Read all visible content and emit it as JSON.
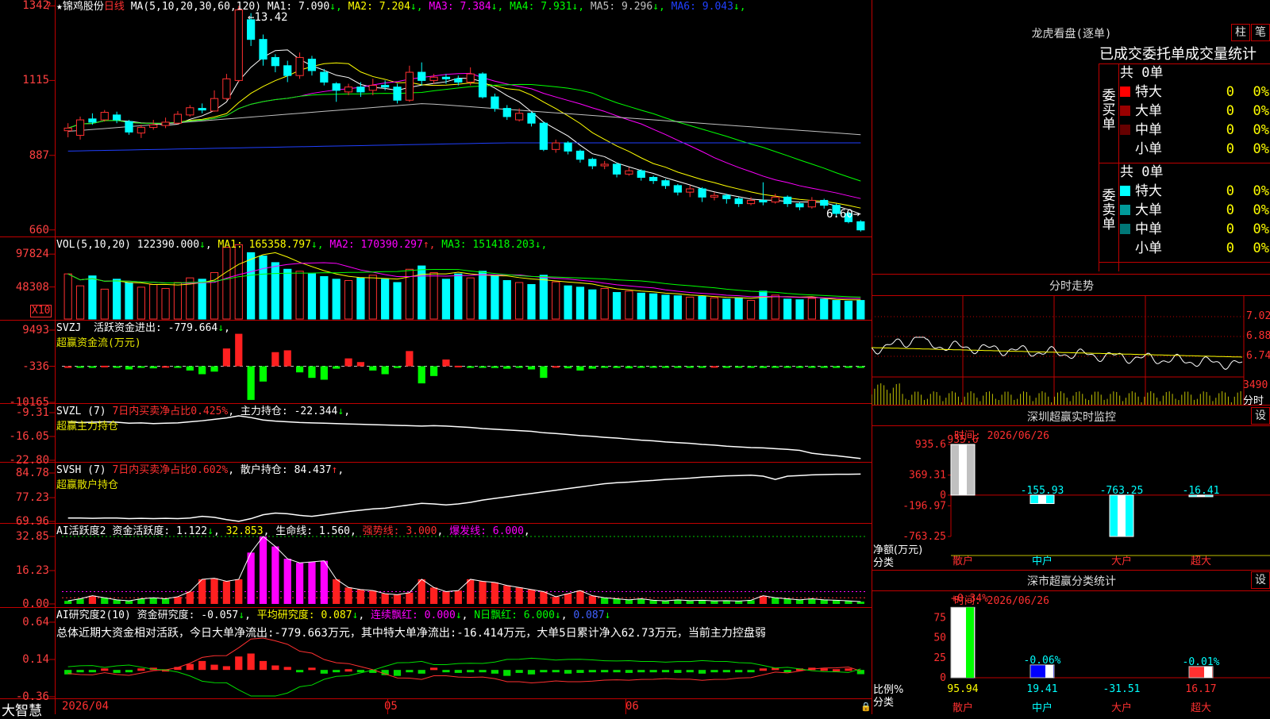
{
  "stock": {
    "name": "锦鸡股份",
    "period": "日线",
    "ma_title": "MA(5,10,20,30,60,120)"
  },
  "main_legend": [
    {
      "label": "MA1:",
      "value": "7.090",
      "arrow": "↓",
      "color": "#ffffff"
    },
    {
      "label": "MA2:",
      "value": "7.204",
      "arrow": "↓",
      "color": "#ffff00"
    },
    {
      "label": "MA3:",
      "value": "7.384",
      "arrow": "↓",
      "color": "#ff00ff"
    },
    {
      "label": "MA4:",
      "value": "7.931",
      "arrow": "↓",
      "color": "#00ff00"
    },
    {
      "label": "MA5:",
      "value": "9.296",
      "arrow": "↓",
      "color": "#c0c0c0"
    },
    {
      "label": "MA6:",
      "value": "9.043",
      "arrow": "↓",
      "color": "#2040ff"
    }
  ],
  "main_yticks": [
    "1342",
    "1115",
    "887",
    "660"
  ],
  "main_annotations": {
    "high": "13.42",
    "low": "6.60"
  },
  "vol": {
    "title": "VOL(5,10,20)",
    "value": "122390.000",
    "arrow": "↓",
    "legend": [
      {
        "label": "MA1:",
        "value": "165358.797",
        "arrow": "↓",
        "color": "#ffff00"
      },
      {
        "label": "MA2:",
        "value": "170390.297",
        "arrow": "↑",
        "color": "#ff00ff"
      },
      {
        "label": "MA3:",
        "value": "151418.203",
        "arrow": "↓",
        "color": "#00ff00"
      }
    ],
    "yticks": [
      "97824",
      "48308"
    ],
    "unit": "X10"
  },
  "svzj": {
    "title": "SVZJ",
    "label": "活跃资金进出:",
    "value": "-779.664",
    "arrow": "↓",
    "subtitle": "超赢资金流(万元)",
    "yticks": [
      "9493",
      "-336",
      "-10165"
    ]
  },
  "svzl": {
    "title": "SVZL (7)",
    "label1": "7日内买卖净占比",
    "v1": "0.425%",
    "label2": "主力持仓:",
    "v2": "-22.344",
    "arrow": "↓",
    "subtitle": "超赢主力持仓",
    "yticks": [
      "-9.31",
      "-16.05",
      "-22.80"
    ]
  },
  "svsh": {
    "title": "SVSH (7)",
    "label1": "7日内买卖净占比",
    "v1": "0.602%",
    "label2": "散户持仓:",
    "v2": "84.437",
    "arrow": "↑",
    "subtitle": "超赢散户持仓",
    "yticks": [
      "84.78",
      "77.23",
      "69.96"
    ]
  },
  "ai1": {
    "title": "AI活跃度2",
    "l1": "资金活跃度:",
    "v1": "1.122",
    "a1": "↓",
    "v1b": "32.853",
    "l2": "生命线:",
    "v2": "1.560",
    "l3": "强势线:",
    "v3": "3.000",
    "l4": "爆发线:",
    "v4": "6.000",
    "yticks": [
      "32.85",
      "16.23",
      "0.00"
    ]
  },
  "ai2": {
    "title": "AI研究度2(10)",
    "l1": "资金研究度:",
    "v1": "-0.057",
    "a1": "↓",
    "l2": "平均研究度:",
    "v2": "0.087",
    "a2": "↓",
    "l3": "连续飘红:",
    "v3": "0.000",
    "a3": "↓",
    "l4": "N日飘红:",
    "v4": "6.000",
    "a4": "↓",
    "v5": "0.087",
    "a5": "↓",
    "summary": "总体近期大资金相对活跃，今日大单净流出:-779.663万元，其中特大单净流出:-16.414万元，大单5日累计净入62.73万元，当前主力控盘弱",
    "yticks": [
      "0.64",
      "0.14",
      "-0.36"
    ]
  },
  "xaxis": {
    "logo": "大智慧",
    "labels": [
      "2026/04",
      "05",
      "06"
    ]
  },
  "corner_marks": [
    "?",
    "?"
  ],
  "longhu": {
    "title": "龙虎看盘(逐单)",
    "btn1": "柱",
    "btn2": "笔",
    "subtitle": "已成交委托单成交量统计",
    "buy": {
      "side": "委买单",
      "total": "共 0单",
      "rows": [
        {
          "label": "特大",
          "n": "0",
          "pct": "0%",
          "color": "#ff0000"
        },
        {
          "label": "大单",
          "n": "0",
          "pct": "0%",
          "color": "#990000"
        },
        {
          "label": "中单",
          "n": "0",
          "pct": "0%",
          "color": "#660000"
        },
        {
          "label": "小单",
          "n": "0",
          "pct": "0%",
          "color": "#000000"
        }
      ]
    },
    "sell": {
      "side": "委卖单",
      "total": "共 0单",
      "rows": [
        {
          "label": "特大",
          "n": "0",
          "pct": "0%",
          "color": "#00ffff"
        },
        {
          "label": "大单",
          "n": "0",
          "pct": "0%",
          "color": "#009999"
        },
        {
          "label": "中单",
          "n": "0",
          "pct": "0%",
          "color": "#007777"
        },
        {
          "label": "小单",
          "n": "0",
          "pct": "0%",
          "color": "#000000"
        }
      ]
    }
  },
  "fenshi": {
    "title": "分时走势",
    "yticks": [
      "7.02",
      "6.88",
      "6.74"
    ],
    "vol_label": "3490",
    "vol_unit": "分时"
  },
  "szmon": {
    "title": "深圳超赢实时监控",
    "btn": "设",
    "time": "时间: 2026/06/26",
    "yticks": [
      "935.6",
      "369.31",
      "0",
      "-196.97",
      "-763.25"
    ],
    "ylabel": "净额(万元)",
    "xlabel": "分类",
    "values": [
      "935.6",
      "-155.93",
      "-763.25",
      "-16.41"
    ],
    "cats": [
      "散户",
      "中户",
      "大户",
      "超大"
    ]
  },
  "szcls": {
    "title": "深市超赢分类统计",
    "btn": "设",
    "time": "时间: 2026/06/26",
    "yticks": [
      "75",
      "50",
      "25",
      "0"
    ],
    "ylabel": "比例%",
    "xlabel": "分类",
    "top": [
      "+0.34%",
      "-0.06%",
      "-0.01%"
    ],
    "bottom": [
      "95.94",
      "19.41",
      "-31.51",
      "16.17"
    ],
    "cats": [
      "散户",
      "中户",
      "大户",
      "超大"
    ]
  },
  "chart_data": [
    {
      "type": "candlestick",
      "title": "锦鸡股份 日线",
      "ylim": [
        6.4,
        13.6
      ],
      "candles": [
        [
          9.62,
          9.7,
          9.42,
          9.85
        ],
        [
          9.48,
          9.95,
          9.35,
          10.05
        ],
        [
          9.98,
          9.88,
          9.8,
          10.15
        ],
        [
          9.95,
          10.18,
          9.9,
          10.25
        ],
        [
          10.1,
          9.95,
          9.85,
          10.2
        ],
        [
          9.9,
          9.58,
          9.5,
          9.95
        ],
        [
          9.55,
          9.72,
          9.4,
          9.8
        ],
        [
          9.72,
          9.8,
          9.65,
          9.95
        ],
        [
          9.78,
          9.88,
          9.7,
          10.02
        ],
        [
          9.85,
          10.12,
          9.82,
          10.22
        ],
        [
          10.1,
          10.32,
          10.05,
          10.4
        ],
        [
          10.3,
          10.25,
          10.15,
          10.45
        ],
        [
          10.22,
          10.6,
          10.2,
          10.85
        ],
        [
          10.6,
          11.2,
          10.55,
          11.35
        ],
        [
          11.15,
          13.3,
          11.1,
          13.42
        ],
        [
          13.0,
          12.4,
          12.2,
          13.2
        ],
        [
          12.4,
          11.8,
          11.6,
          12.55
        ],
        [
          11.85,
          11.6,
          11.4,
          11.95
        ],
        [
          11.6,
          11.3,
          11.1,
          11.75
        ],
        [
          11.3,
          11.85,
          11.2,
          12.0
        ],
        [
          11.8,
          11.45,
          11.3,
          11.9
        ],
        [
          11.4,
          11.1,
          11.0,
          11.5
        ],
        [
          11.05,
          10.85,
          10.5,
          11.1
        ],
        [
          10.8,
          10.95,
          10.7,
          11.05
        ],
        [
          10.95,
          10.8,
          10.65,
          11.1
        ],
        [
          10.85,
          11.0,
          10.7,
          11.2
        ],
        [
          11.0,
          10.95,
          10.85,
          11.15
        ],
        [
          10.95,
          10.55,
          10.45,
          11.05
        ],
        [
          10.55,
          11.4,
          10.5,
          11.6
        ],
        [
          11.4,
          11.15,
          11.0,
          11.7
        ],
        [
          11.15,
          11.25,
          11.05,
          11.35
        ],
        [
          11.25,
          11.2,
          11.05,
          11.35
        ],
        [
          11.2,
          11.1,
          11.0,
          11.3
        ],
        [
          11.1,
          11.35,
          11.0,
          11.55
        ],
        [
          11.35,
          10.65,
          10.6,
          11.4
        ],
        [
          10.65,
          10.3,
          10.2,
          10.75
        ],
        [
          10.3,
          10.05,
          9.95,
          10.4
        ],
        [
          9.95,
          10.15,
          9.9,
          10.3
        ],
        [
          10.15,
          9.85,
          9.75,
          10.2
        ],
        [
          9.85,
          9.05,
          9.0,
          9.9
        ],
        [
          9.05,
          9.25,
          8.95,
          9.35
        ],
        [
          9.25,
          9.0,
          8.9,
          9.3
        ],
        [
          9.0,
          8.75,
          8.65,
          9.05
        ],
        [
          8.75,
          8.55,
          8.45,
          8.8
        ],
        [
          8.55,
          8.6,
          8.45,
          8.7
        ],
        [
          8.6,
          8.3,
          8.2,
          8.65
        ],
        [
          8.3,
          8.4,
          8.25,
          8.5
        ],
        [
          8.4,
          8.2,
          8.1,
          8.45
        ],
        [
          8.2,
          8.1,
          8.0,
          8.25
        ],
        [
          8.1,
          7.95,
          7.85,
          8.15
        ],
        [
          7.95,
          7.75,
          7.65,
          8.0
        ],
        [
          7.75,
          7.85,
          7.6,
          7.95
        ],
        [
          7.85,
          7.6,
          7.45,
          7.9
        ],
        [
          7.6,
          7.65,
          7.5,
          7.75
        ],
        [
          7.65,
          7.55,
          7.4,
          7.7
        ],
        [
          7.55,
          7.4,
          7.3,
          7.6
        ],
        [
          7.4,
          7.5,
          7.35,
          7.6
        ],
        [
          7.5,
          7.45,
          7.35,
          8.05
        ],
        [
          7.45,
          7.6,
          7.4,
          7.7
        ],
        [
          7.6,
          7.4,
          7.3,
          7.65
        ],
        [
          7.4,
          7.3,
          7.2,
          7.45
        ],
        [
          7.3,
          7.5,
          7.25,
          7.6
        ],
        [
          7.5,
          7.35,
          7.25,
          7.55
        ],
        [
          7.35,
          7.1,
          7.0,
          7.4
        ],
        [
          7.1,
          6.85,
          6.8,
          7.15
        ],
        [
          6.85,
          6.6,
          6.55,
          6.9
        ]
      ]
    },
    {
      "type": "bar",
      "title": "VOL(5,10,20)",
      "ylim": [
        0,
        110000
      ],
      "values": [
        68000,
        50000,
        65000,
        45000,
        60000,
        55000,
        48000,
        52000,
        46000,
        55000,
        62000,
        60000,
        70000,
        108000,
        112000,
        100000,
        95000,
        85000,
        75000,
        72000,
        68000,
        64000,
        60000,
        58000,
        62000,
        66000,
        60000,
        55000,
        75000,
        80000,
        70000,
        60000,
        68000,
        62000,
        72000,
        65000,
        58000,
        55000,
        52000,
        66000,
        56000,
        50000,
        48000,
        44000,
        46000,
        40000,
        42000,
        39000,
        38000,
        36000,
        35000,
        33000,
        34000,
        32000,
        30000,
        32000,
        28000,
        42000,
        36000,
        30000,
        29000,
        31000,
        30000,
        28000,
        27000,
        28000
      ]
    },
    {
      "type": "bar",
      "title": "SVZJ",
      "ylim": [
        -10165,
        9493
      ],
      "values": [
        -336,
        -500,
        -600,
        -200,
        -400,
        -1200,
        -500,
        -900,
        -300,
        -700,
        -1500,
        -2500,
        -1800,
        4500,
        8500,
        -9500,
        -4500,
        3500,
        4000,
        -2000,
        -3500,
        -4000,
        -1000,
        1800,
        800,
        -1500,
        -2500,
        -800,
        3800,
        -5000,
        -3000,
        1500,
        -200,
        -600,
        -400,
        -800,
        -1000,
        -600,
        -1200,
        -3500,
        -300,
        -900,
        -1500,
        -1000,
        -700,
        -800,
        -900,
        -600,
        -700,
        -500,
        -700,
        -400,
        -600,
        -300,
        -500,
        -400,
        -600,
        -800,
        -700,
        -500,
        -600,
        -400,
        -500,
        -600,
        -500,
        -780
      ]
    },
    {
      "type": "line",
      "title": "SVZL (7)",
      "ylim": [
        -22.8,
        -9.31
      ],
      "values": [
        -12.0,
        -12.1,
        -12.0,
        -11.9,
        -12.0,
        -12.3,
        -12.2,
        -12.4,
        -12.3,
        -12.2,
        -11.9,
        -11.6,
        -11.2,
        -10.8,
        -10.2,
        -10.7,
        -11.4,
        -11.7,
        -11.9,
        -12.1,
        -12.2,
        -12.3,
        -12.4,
        -12.5,
        -12.6,
        -12.7,
        -12.8,
        -12.9,
        -13.0,
        -13.1,
        -13.0,
        -13.1,
        -13.3,
        -13.5,
        -13.8,
        -14.0,
        -14.2,
        -14.4,
        -14.6,
        -15.0,
        -15.2,
        -15.5,
        -15.8,
        -16.0,
        -16.3,
        -16.5,
        -16.8,
        -17.1,
        -17.3,
        -17.6,
        -17.8,
        -18.0,
        -18.3,
        -18.5,
        -18.8,
        -19.0,
        -19.2,
        -19.3,
        -19.5,
        -19.7,
        -20.0,
        -20.8,
        -21.2,
        -21.5,
        -21.9,
        -22.3
      ]
    },
    {
      "type": "line",
      "title": "SVSH (7)",
      "ylim": [
        69.96,
        84.78
      ],
      "values": [
        71.0,
        71.0,
        70.9,
        71.0,
        71.0,
        70.8,
        70.9,
        70.8,
        70.9,
        70.8,
        71.0,
        71.5,
        71.2,
        70.5,
        70.0,
        70.8,
        72.0,
        72.5,
        72.3,
        71.8,
        71.5,
        72.0,
        72.5,
        73.0,
        73.4,
        73.8,
        74.0,
        74.5,
        75.0,
        75.5,
        75.3,
        75.0,
        75.3,
        75.8,
        76.5,
        77.0,
        77.5,
        78.0,
        78.5,
        79.0,
        79.5,
        80.0,
        80.5,
        81.0,
        81.5,
        81.8,
        82.0,
        82.3,
        82.5,
        82.8,
        83.0,
        83.2,
        83.5,
        83.7,
        83.9,
        84.0,
        84.1,
        83.8,
        82.8,
        83.8,
        84.0,
        84.2,
        84.3,
        84.4,
        84.4,
        84.44
      ]
    },
    {
      "type": "bar",
      "title": "AI活跃度2",
      "ylim": [
        0,
        32.85
      ],
      "values": [
        1.5,
        2.5,
        4.0,
        3.0,
        2.0,
        1.5,
        2.5,
        3.0,
        2.5,
        3.5,
        6.0,
        12.0,
        12.5,
        11.0,
        12.0,
        25.0,
        32.85,
        28.0,
        22.0,
        20.0,
        20.5,
        21.0,
        12.0,
        8.0,
        7.0,
        6.5,
        5.0,
        4.5,
        5.5,
        12.0,
        8.0,
        6.0,
        6.5,
        12.0,
        11.0,
        10.5,
        9.0,
        8.0,
        7.0,
        6.0,
        3.5,
        5.0,
        6.5,
        4.0,
        3.0,
        2.5,
        2.0,
        2.5,
        1.8,
        1.5,
        2.0,
        1.6,
        1.8,
        1.5,
        1.6,
        1.4,
        1.8,
        4.0,
        3.0,
        2.5,
        2.0,
        2.5,
        2.0,
        1.8,
        1.5,
        1.12
      ]
    },
    {
      "type": "bar",
      "title": "AI研究度2(10)",
      "ylim": [
        -0.36,
        0.64
      ],
      "values": [
        -0.06,
        -0.03,
        -0.02,
        0.02,
        -0.04,
        -0.03,
        0.02,
        0.03,
        0.01,
        0.04,
        0.08,
        0.12,
        0.07,
        0.05,
        0.18,
        0.22,
        0.12,
        0.06,
        0.04,
        -0.03,
        0.03,
        -0.05,
        -0.02,
        0.01,
        -0.03,
        -0.04,
        -0.07,
        -0.08,
        -0.03,
        -0.05,
        0.03,
        -0.02,
        -0.04,
        -0.03,
        -0.02,
        -0.05,
        -0.08,
        -0.04,
        -0.06,
        -0.03,
        -0.02,
        -0.05,
        -0.04,
        -0.03,
        -0.02,
        -0.03,
        -0.04,
        -0.02,
        -0.03,
        -0.02,
        -0.04,
        -0.03,
        -0.05,
        -0.02,
        -0.03,
        -0.01,
        -0.02,
        0.02,
        0.03,
        -0.02,
        0.02,
        0.03,
        0.02,
        0.01,
        0.02,
        -0.057
      ]
    }
  ]
}
